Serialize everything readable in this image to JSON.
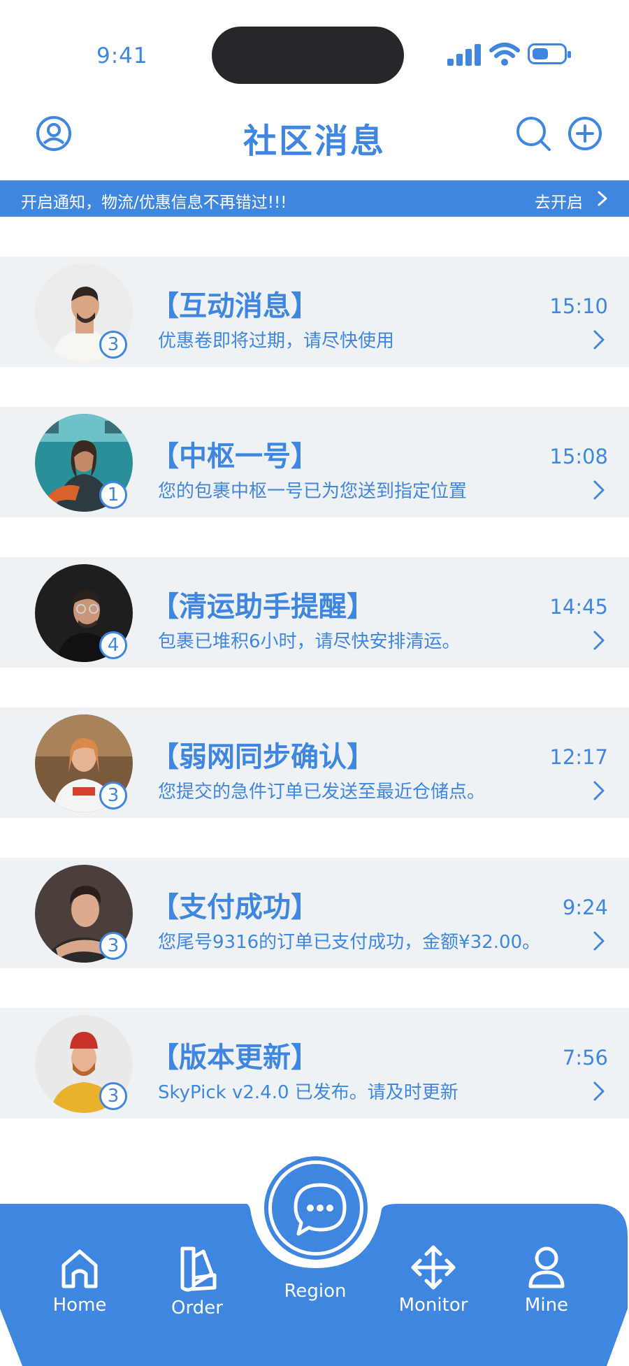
{
  "status_bar": {
    "time": "9:41"
  },
  "header": {
    "title": "社区消息"
  },
  "notice": {
    "message": "开启通知，物流/优惠信息不再错过!!!",
    "action": "去开启"
  },
  "messages": [
    {
      "title": "【互动消息】",
      "preview": "优惠卷即将过期，请尽快使用",
      "time": "15:10",
      "badge": "3"
    },
    {
      "title": "【中枢一号】",
      "preview": "您的包裹中枢一号已为您送到指定位置",
      "time": "15:08",
      "badge": "1"
    },
    {
      "title": "【清运助手提醒】",
      "preview": "包裹已堆积6小时，请尽快安排清运。",
      "time": "14:45",
      "badge": "4"
    },
    {
      "title": "【弱网同步确认】",
      "preview": "您提交的急件订单已发送至最近仓储点。",
      "time": "12:17",
      "badge": "3"
    },
    {
      "title": "【支付成功】",
      "preview": "您尾号9316的订单已支付成功，金额¥32.00。",
      "time": "9:24",
      "badge": "3"
    },
    {
      "title": "【版本更新】",
      "preview": "SkyPick v2.4.0 已发布。请及时更新",
      "time": "7:56",
      "badge": "3"
    }
  ],
  "tabbar": {
    "home": "Home",
    "order": "Order",
    "region": "Region",
    "monitor": "Monitor",
    "mine": "Mine"
  },
  "colors": {
    "accent": "#3f86e0",
    "card_bg": "#eff2f5",
    "island": "#26272b"
  },
  "icons": [
    "profile-icon",
    "search-icon",
    "add-icon",
    "chevron-right-icon",
    "chat-bubble-icon",
    "home-icon",
    "order-swatch-icon",
    "move-icon",
    "person-icon"
  ]
}
